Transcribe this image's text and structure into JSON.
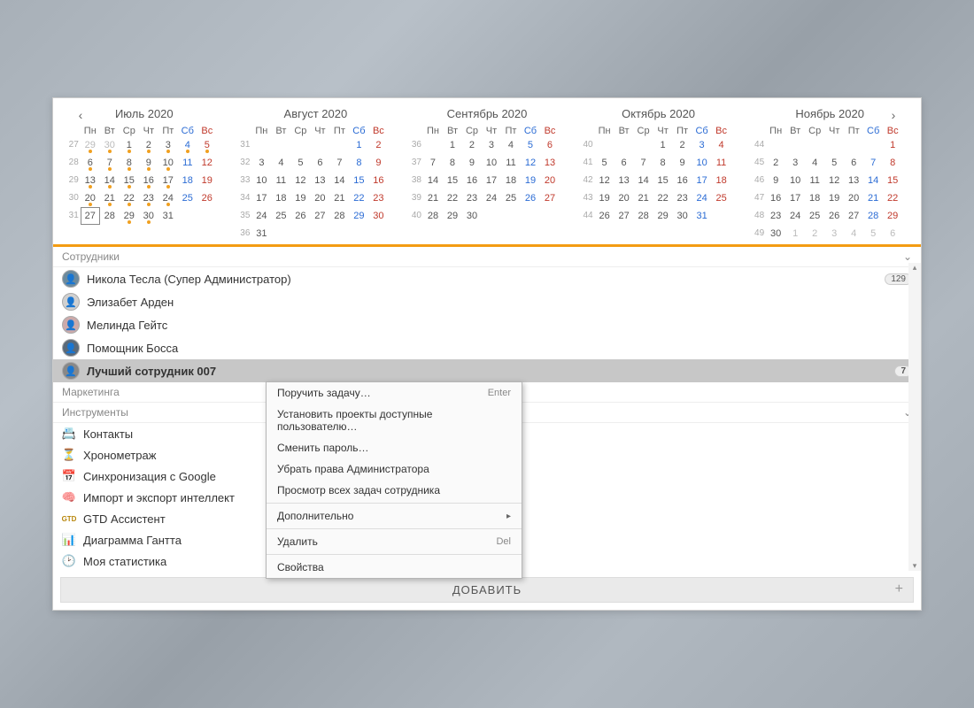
{
  "calendar": {
    "months": [
      {
        "title": "Июль 2020",
        "dow": [
          "Пн",
          "Вт",
          "Ср",
          "Чт",
          "Пт",
          "Сб",
          "Вс"
        ],
        "today": 27,
        "marks": [
          29,
          30,
          1,
          2,
          3,
          4,
          5,
          6,
          7,
          8,
          9,
          10,
          13,
          14,
          15,
          16,
          17,
          20,
          21,
          22,
          23,
          24
        ],
        "weeks": [
          {
            "num": 27,
            "days": [
              {
                "d": 29,
                "dim": true
              },
              {
                "d": 30,
                "dim": true
              },
              {
                "d": 1
              },
              {
                "d": 2
              },
              {
                "d": 3
              },
              {
                "d": 4,
                "sat": true
              },
              {
                "d": 5,
                "sun": true
              }
            ]
          },
          {
            "num": 28,
            "days": [
              {
                "d": 6
              },
              {
                "d": 7
              },
              {
                "d": 8
              },
              {
                "d": 9
              },
              {
                "d": 10
              },
              {
                "d": 11,
                "sat": true
              },
              {
                "d": 12,
                "sun": true
              }
            ]
          },
          {
            "num": 29,
            "days": [
              {
                "d": 13
              },
              {
                "d": 14
              },
              {
                "d": 15
              },
              {
                "d": 16
              },
              {
                "d": 17
              },
              {
                "d": 18,
                "sat": true
              },
              {
                "d": 19,
                "sun": true
              }
            ]
          },
          {
            "num": 30,
            "days": [
              {
                "d": 20
              },
              {
                "d": 21
              },
              {
                "d": 22
              },
              {
                "d": 23
              },
              {
                "d": 24
              },
              {
                "d": 25,
                "sat": true
              },
              {
                "d": 26,
                "sun": true
              }
            ]
          },
          {
            "num": 31,
            "days": [
              {
                "d": 27
              },
              {
                "d": 28
              },
              {
                "d": 29
              },
              {
                "d": 30
              },
              {
                "d": 31
              },
              {
                "d": null
              },
              {
                "d": null
              }
            ]
          }
        ]
      },
      {
        "title": "Август 2020",
        "dow": [
          "Пн",
          "Вт",
          "Ср",
          "Чт",
          "Пт",
          "Сб",
          "Вс"
        ],
        "weeks": [
          {
            "num": 31,
            "days": [
              {
                "d": null
              },
              {
                "d": null
              },
              {
                "d": null
              },
              {
                "d": null
              },
              {
                "d": null
              },
              {
                "d": 1,
                "sat": true
              },
              {
                "d": 2,
                "sun": true
              }
            ]
          },
          {
            "num": 32,
            "days": [
              {
                "d": 3
              },
              {
                "d": 4
              },
              {
                "d": 5
              },
              {
                "d": 6
              },
              {
                "d": 7
              },
              {
                "d": 8,
                "sat": true
              },
              {
                "d": 9,
                "sun": true
              }
            ]
          },
          {
            "num": 33,
            "days": [
              {
                "d": 10
              },
              {
                "d": 11
              },
              {
                "d": 12
              },
              {
                "d": 13
              },
              {
                "d": 14
              },
              {
                "d": 15,
                "sat": true
              },
              {
                "d": 16,
                "sun": true
              }
            ]
          },
          {
            "num": 34,
            "days": [
              {
                "d": 17
              },
              {
                "d": 18
              },
              {
                "d": 19
              },
              {
                "d": 20
              },
              {
                "d": 21
              },
              {
                "d": 22,
                "sat": true
              },
              {
                "d": 23,
                "sun": true
              }
            ]
          },
          {
            "num": 35,
            "days": [
              {
                "d": 24
              },
              {
                "d": 25
              },
              {
                "d": 26
              },
              {
                "d": 27
              },
              {
                "d": 28
              },
              {
                "d": 29,
                "sat": true
              },
              {
                "d": 30,
                "sun": true
              }
            ]
          },
          {
            "num": 36,
            "days": [
              {
                "d": 31
              },
              {
                "d": null
              },
              {
                "d": null
              },
              {
                "d": null
              },
              {
                "d": null
              },
              {
                "d": null
              },
              {
                "d": null
              }
            ]
          }
        ]
      },
      {
        "title": "Сентябрь 2020",
        "dow": [
          "Пн",
          "Вт",
          "Ср",
          "Чт",
          "Пт",
          "Сб",
          "Вс"
        ],
        "weeks": [
          {
            "num": 36,
            "days": [
              {
                "d": null
              },
              {
                "d": 1
              },
              {
                "d": 2
              },
              {
                "d": 3
              },
              {
                "d": 4
              },
              {
                "d": 5,
                "sat": true
              },
              {
                "d": 6,
                "sun": true
              }
            ]
          },
          {
            "num": 37,
            "days": [
              {
                "d": 7
              },
              {
                "d": 8
              },
              {
                "d": 9
              },
              {
                "d": 10
              },
              {
                "d": 11
              },
              {
                "d": 12,
                "sat": true
              },
              {
                "d": 13,
                "sun": true
              }
            ]
          },
          {
            "num": 38,
            "days": [
              {
                "d": 14
              },
              {
                "d": 15
              },
              {
                "d": 16
              },
              {
                "d": 17
              },
              {
                "d": 18
              },
              {
                "d": 19,
                "sat": true
              },
              {
                "d": 20,
                "sun": true
              }
            ]
          },
          {
            "num": 39,
            "days": [
              {
                "d": 21
              },
              {
                "d": 22
              },
              {
                "d": 23
              },
              {
                "d": 24
              },
              {
                "d": 25
              },
              {
                "d": 26,
                "sat": true
              },
              {
                "d": 27,
                "sun": true
              }
            ]
          },
          {
            "num": 40,
            "days": [
              {
                "d": 28
              },
              {
                "d": 29
              },
              {
                "d": 30
              },
              {
                "d": null
              },
              {
                "d": null
              },
              {
                "d": null
              },
              {
                "d": null
              }
            ]
          }
        ]
      },
      {
        "title": "Октябрь 2020",
        "dow": [
          "Пн",
          "Вт",
          "Ср",
          "Чт",
          "Пт",
          "Сб",
          "Вс"
        ],
        "weeks": [
          {
            "num": 40,
            "days": [
              {
                "d": null
              },
              {
                "d": null
              },
              {
                "d": null
              },
              {
                "d": 1
              },
              {
                "d": 2
              },
              {
                "d": 3,
                "sat": true
              },
              {
                "d": 4,
                "sun": true
              }
            ]
          },
          {
            "num": 41,
            "days": [
              {
                "d": 5
              },
              {
                "d": 6
              },
              {
                "d": 7
              },
              {
                "d": 8
              },
              {
                "d": 9
              },
              {
                "d": 10,
                "sat": true
              },
              {
                "d": 11,
                "sun": true
              }
            ]
          },
          {
            "num": 42,
            "days": [
              {
                "d": 12
              },
              {
                "d": 13
              },
              {
                "d": 14
              },
              {
                "d": 15
              },
              {
                "d": 16
              },
              {
                "d": 17,
                "sat": true
              },
              {
                "d": 18,
                "sun": true
              }
            ]
          },
          {
            "num": 43,
            "days": [
              {
                "d": 19
              },
              {
                "d": 20
              },
              {
                "d": 21
              },
              {
                "d": 22
              },
              {
                "d": 23
              },
              {
                "d": 24,
                "sat": true
              },
              {
                "d": 25,
                "sun": true
              }
            ]
          },
          {
            "num": 44,
            "days": [
              {
                "d": 26
              },
              {
                "d": 27
              },
              {
                "d": 28
              },
              {
                "d": 29
              },
              {
                "d": 30
              },
              {
                "d": 31,
                "sat": true
              },
              {
                "d": null
              }
            ]
          }
        ]
      },
      {
        "title": "Ноябрь 2020",
        "dow": [
          "Пн",
          "Вт",
          "Ср",
          "Чт",
          "Пт",
          "Сб",
          "Вс"
        ],
        "weeks": [
          {
            "num": 44,
            "days": [
              {
                "d": null
              },
              {
                "d": null
              },
              {
                "d": null
              },
              {
                "d": null
              },
              {
                "d": null
              },
              {
                "d": null
              },
              {
                "d": 1,
                "sun": true
              }
            ]
          },
          {
            "num": 45,
            "days": [
              {
                "d": 2
              },
              {
                "d": 3
              },
              {
                "d": 4
              },
              {
                "d": 5
              },
              {
                "d": 6
              },
              {
                "d": 7,
                "sat": true
              },
              {
                "d": 8,
                "sun": true
              }
            ]
          },
          {
            "num": 46,
            "days": [
              {
                "d": 9
              },
              {
                "d": 10
              },
              {
                "d": 11
              },
              {
                "d": 12
              },
              {
                "d": 13
              },
              {
                "d": 14,
                "sat": true
              },
              {
                "d": 15,
                "sun": true
              }
            ]
          },
          {
            "num": 47,
            "days": [
              {
                "d": 16
              },
              {
                "d": 17
              },
              {
                "d": 18
              },
              {
                "d": 19
              },
              {
                "d": 20
              },
              {
                "d": 21,
                "sat": true
              },
              {
                "d": 22,
                "sun": true
              }
            ]
          },
          {
            "num": 48,
            "days": [
              {
                "d": 23
              },
              {
                "d": 24
              },
              {
                "d": 25
              },
              {
                "d": 26
              },
              {
                "d": 27
              },
              {
                "d": 28,
                "sat": true
              },
              {
                "d": 29,
                "sun": true
              }
            ]
          },
          {
            "num": 49,
            "days": [
              {
                "d": 30
              },
              {
                "d": 1,
                "dim": true
              },
              {
                "d": 2,
                "dim": true
              },
              {
                "d": 3,
                "dim": true
              },
              {
                "d": 4,
                "dim": true
              },
              {
                "d": 5,
                "dim": true
              },
              {
                "d": 6,
                "dim": true
              }
            ]
          }
        ]
      }
    ]
  },
  "sections": {
    "employees_title": "Сотрудники",
    "marketing_title": "Маркетинга",
    "tools_title": "Инструменты"
  },
  "employees": [
    {
      "name": "Никола Тесла (Супер Администратор)",
      "badge": "129",
      "avatar_bg": "#6b8a9e"
    },
    {
      "name": "Элизабет Арден",
      "avatar_bg": "#d0d0d0"
    },
    {
      "name": "Мелинда Гейтс",
      "avatar_bg": "#caa"
    },
    {
      "name": "Помощник Босса",
      "avatar_bg": "#5a6a7a"
    },
    {
      "name": "Лучший сотрудник 007",
      "badge": "7",
      "selected": true,
      "avatar_bg": "#888"
    }
  ],
  "tools": [
    {
      "icon": "📇",
      "label": "Контакты"
    },
    {
      "icon": "⏳",
      "label": "Хронометраж"
    },
    {
      "icon": "📅",
      "label": "Синхронизация с Google"
    },
    {
      "icon": "🧠",
      "label": "Импорт и экспорт интеллект"
    },
    {
      "icon": "GTD",
      "label": "GTD Ассистент",
      "text_icon": true
    },
    {
      "icon": "📊",
      "label": "Диаграмма Гантта"
    },
    {
      "icon": "🕑",
      "label": "Моя статистика"
    }
  ],
  "context_menu": {
    "items": [
      {
        "label": "Поручить задачу…",
        "shortcut": "Enter"
      },
      {
        "label": "Установить проекты доступные пользователю…"
      },
      {
        "label": "Сменить пароль…"
      },
      {
        "label": "Убрать права Администратора"
      },
      {
        "label": "Просмотр всех задач сотрудника"
      },
      {
        "sep": true
      },
      {
        "label": "Дополнительно",
        "submenu": true
      },
      {
        "sep": true
      },
      {
        "label": "Удалить",
        "shortcut": "Del"
      },
      {
        "sep": true
      },
      {
        "label": "Свойства"
      }
    ]
  },
  "add_button": "ДОБАВИТЬ"
}
